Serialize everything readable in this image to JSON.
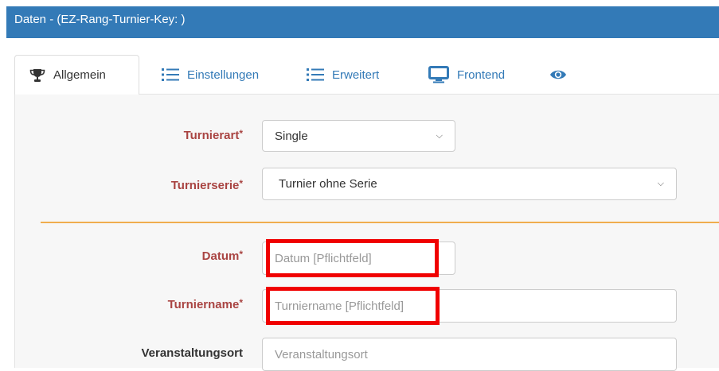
{
  "header": {
    "title": "Daten - (EZ-Rang-Turnier-Key: )"
  },
  "tabs": [
    {
      "label": "Allgemein",
      "icon": "trophy-icon",
      "active": true
    },
    {
      "label": "Einstellungen",
      "icon": "list-icon",
      "active": false
    },
    {
      "label": "Erweitert",
      "icon": "list-icon",
      "active": false
    },
    {
      "label": "Frontend",
      "icon": "monitor-icon",
      "active": false
    },
    {
      "label": "",
      "icon": "eye-icon",
      "active": false
    }
  ],
  "form": {
    "turnierart": {
      "label": "Turnierart",
      "required_mark": "*",
      "value": "Single"
    },
    "turnierserie": {
      "label": "Turnierserie",
      "required_mark": "*",
      "value": "Turnier ohne Serie"
    },
    "datum": {
      "label": "Datum",
      "required_mark": "*",
      "placeholder": "Datum [Pflichtfeld]"
    },
    "turniername": {
      "label": "Turniername",
      "required_mark": "*",
      "placeholder": "Turniername [Pflichtfeld]"
    },
    "veranstaltungsort": {
      "label": "Veranstaltungsort",
      "placeholder": "Veranstaltungsort"
    }
  },
  "colors": {
    "header_bg": "#337ab7",
    "required_label": "#a94442",
    "link": "#337ab7",
    "divider": "#f0ad4e",
    "highlight": "#f00000"
  }
}
